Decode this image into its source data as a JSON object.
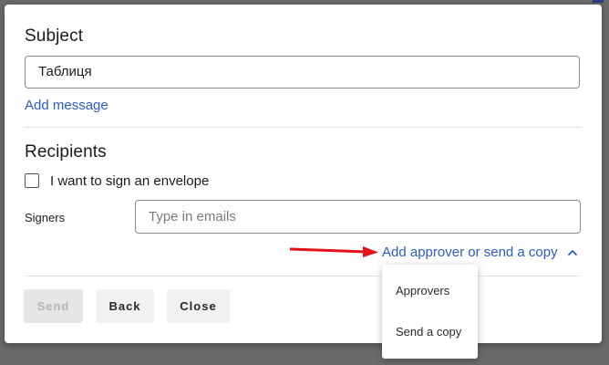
{
  "dialog": {
    "subject": {
      "title": "Subject",
      "value": "Таблиця"
    },
    "add_message_label": "Add message",
    "recipients": {
      "title": "Recipients",
      "self_sign_label": "I want to sign an envelope",
      "self_sign_checked": false,
      "signers_label": "Signers",
      "signers_placeholder": "Type in emails"
    },
    "approver_link": {
      "label": "Add approver or send a copy",
      "icon": "chevron-up-icon",
      "color": "#2a5bc7"
    },
    "annotation": {
      "icon": "red-arrow",
      "color": "#e3121b"
    },
    "buttons": {
      "send": "Send",
      "back": "Back",
      "close": "Close"
    },
    "dropdown": {
      "items": [
        {
          "label": "Approvers"
        },
        {
          "label": "Send a copy"
        }
      ]
    }
  }
}
